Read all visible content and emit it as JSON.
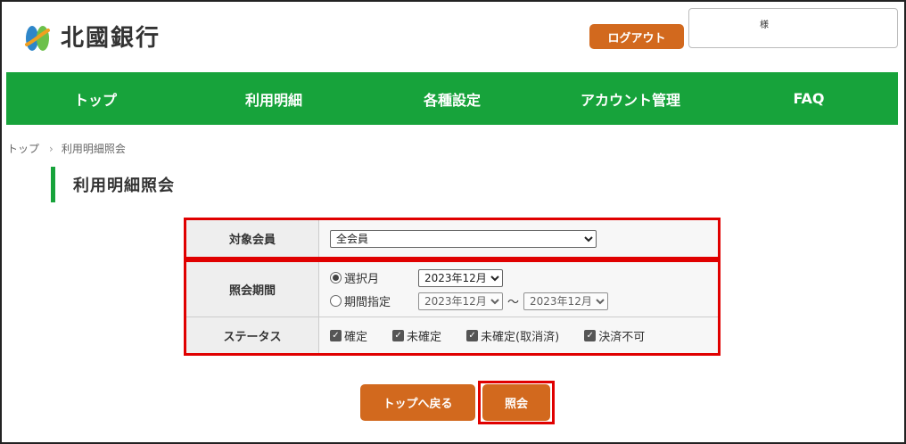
{
  "header": {
    "bank_name": "北國銀行",
    "logout_label": "ログアウト",
    "user_suffix": "様"
  },
  "nav": {
    "items": [
      {
        "label": "トップ"
      },
      {
        "label": "利用明細"
      },
      {
        "label": "各種設定"
      },
      {
        "label": "アカウント管理"
      },
      {
        "label": "FAQ"
      }
    ]
  },
  "breadcrumb": {
    "home": "トップ",
    "separator": "›",
    "current": "利用明細照会"
  },
  "page": {
    "title": "利用明細照会"
  },
  "form": {
    "member": {
      "label": "対象会員",
      "selected": "全会員"
    },
    "period": {
      "label": "照会期間",
      "option_month": "選択月",
      "option_month_selected": true,
      "month_value": "2023年12月",
      "option_range": "期間指定",
      "option_range_selected": false,
      "range_from": "2023年12月",
      "range_sep": "～",
      "range_to": "2023年12月"
    },
    "status": {
      "label": "ステータス",
      "options": [
        {
          "label": "確定",
          "checked": true
        },
        {
          "label": "未確定",
          "checked": true
        },
        {
          "label": "未確定(取消済)",
          "checked": true
        },
        {
          "label": "決済不可",
          "checked": true
        }
      ]
    }
  },
  "buttons": {
    "back_top": "トップへ戻る",
    "submit": "照会"
  },
  "colors": {
    "brand_green": "#17a33b",
    "button_orange": "#d2691e",
    "highlight_red": "#e00000"
  }
}
